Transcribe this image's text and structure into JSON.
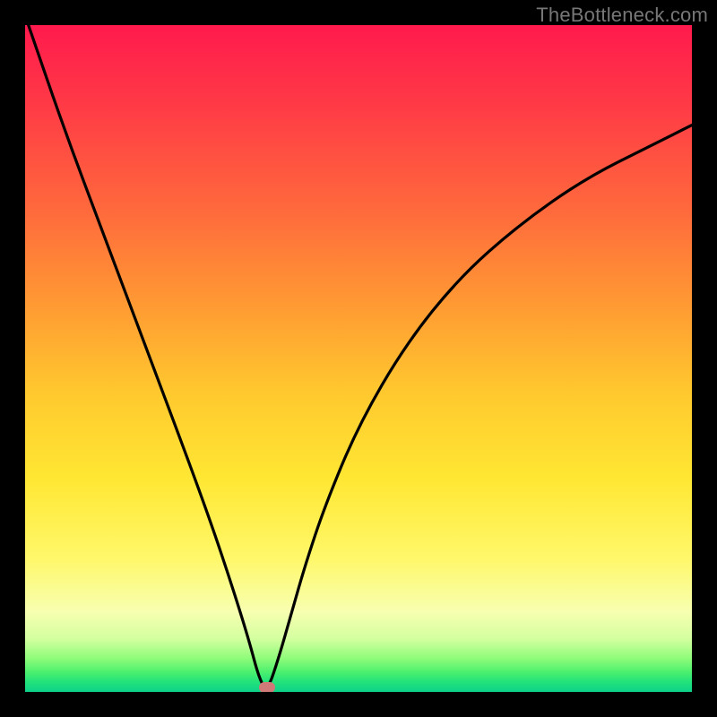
{
  "watermark": "TheBottleneck.com",
  "marker": {
    "x_pct": 36.3,
    "y_pct": 99.3
  },
  "colors": {
    "curve": "#000000",
    "background_frame": "#000000",
    "marker": "#cf7a78"
  },
  "chart_data": {
    "type": "line",
    "title": "",
    "xlabel": "",
    "ylabel": "",
    "xlim": [
      0,
      100
    ],
    "ylim": [
      0,
      100
    ],
    "grid": false,
    "legend": false,
    "series": [
      {
        "name": "bottleneck-curve",
        "x": [
          0.5,
          6,
          12,
          18,
          24,
          28,
          31,
          33.5,
          35.1,
          36.3,
          38,
          40,
          42,
          45,
          50,
          57,
          65,
          74,
          84,
          94,
          100
        ],
        "y": [
          100,
          84,
          68,
          52,
          36,
          25,
          16,
          8,
          2,
          0,
          5,
          12,
          19,
          28,
          40,
          52,
          62,
          70,
          77,
          82,
          85
        ]
      }
    ],
    "notes": "Values are percentages of the plot area (0 at left/bottom, 100 at right/top). Depicts a V-shaped bottleneck curve with minimum near x≈36%."
  }
}
